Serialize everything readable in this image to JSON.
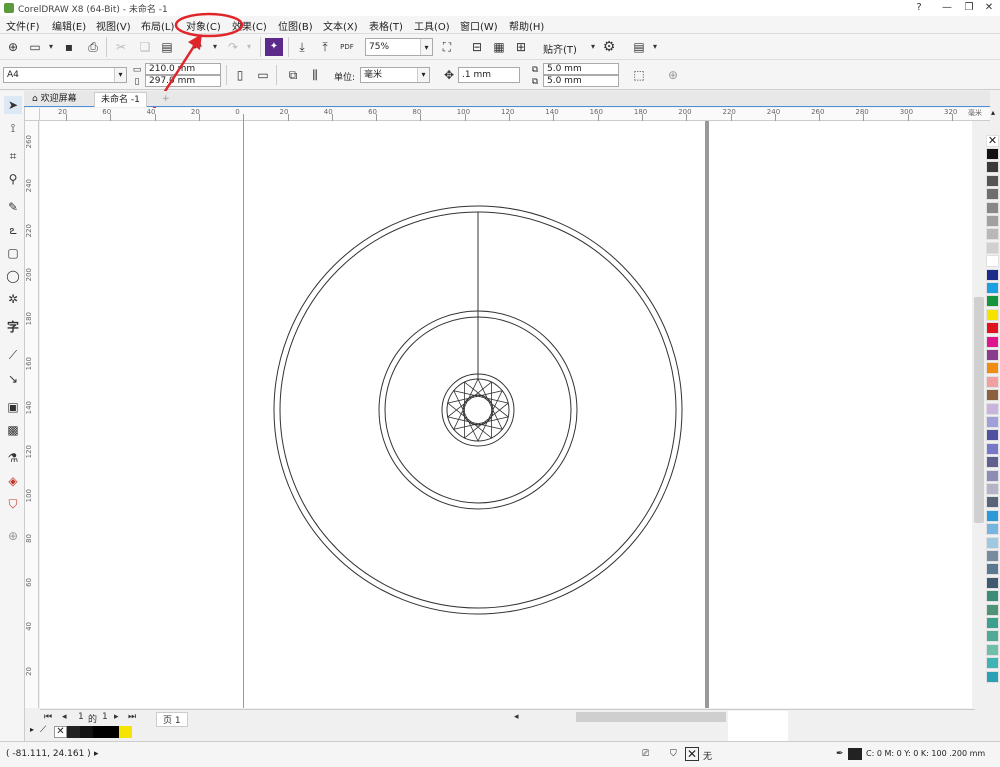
{
  "window": {
    "title": "CorelDRAW X8 (64-Bit) - 未命名 -1",
    "controls": [
      "?",
      "—",
      "❐",
      "✕"
    ]
  },
  "menu": [
    "文件(F)",
    "编辑(E)",
    "视图(V)",
    "布局(L)",
    "对象(C)",
    "效果(C)",
    "位图(B)",
    "文本(X)",
    "表格(T)",
    "工具(O)",
    "窗口(W)",
    "帮助(H)"
  ],
  "toolbar": {
    "zoom": "75%",
    "snap_label": "贴齐(T)",
    "pdf_label": "PDF"
  },
  "property_bar": {
    "page_size": "A4",
    "width": "210.0 mm",
    "height": "297.0 mm",
    "unit_label": "单位:",
    "unit": "毫米",
    "nudge": ".1 mm",
    "dup_x": "5.0 mm",
    "dup_y": "5.0 mm"
  },
  "tabs": [
    "欢迎屏幕",
    "未命名 -1"
  ],
  "ruler": {
    "h_ticks": [
      "20",
      "60",
      "40",
      "20",
      "0",
      "20",
      "40",
      "60",
      "80",
      "100",
      "120",
      "140",
      "160",
      "180",
      "200",
      "220",
      "240",
      "260",
      "280",
      "300",
      "320"
    ],
    "h_unit": "毫米",
    "v_ticks": [
      "260",
      "240",
      "220",
      "200",
      "180",
      "160",
      "140",
      "120",
      "100",
      "80",
      "60",
      "40",
      "20"
    ]
  },
  "page_nav": {
    "current": "1",
    "of_label": "的",
    "total": "1",
    "page_tab": "页 1"
  },
  "status": {
    "coords": "( -81.111, 24.161 )",
    "fill_label": "无",
    "color_info": "C: 0 M: 0 Y: 0 K: 100  .200 mm"
  },
  "colors": {
    "annotation": "#e0262b",
    "palette": [
      "#ffffff",
      "#111111",
      "#3a3a3a",
      "#555555",
      "#6e6e6e",
      "#888888",
      "#a0a0a0",
      "#b8b8b8",
      "#d0d0d0",
      "#ffffff",
      "#1c2a8a",
      "#1ea0e0",
      "#14943c",
      "#f5e400",
      "#e0141e",
      "#e0148c",
      "#8a3c8c",
      "#f08c14",
      "#f0a0a0",
      "#8a6040",
      "#c8b4dc",
      "#a0a0d8",
      "#5050a0",
      "#7878c8",
      "#606090",
      "#8c8cb4",
      "#b4b4c8",
      "#5a6478",
      "#2c9ad8",
      "#78b4e0",
      "#a0c8e0",
      "#788ca0",
      "#5a7890",
      "#405870",
      "#3c8c78",
      "#509478",
      "#3ca08c",
      "#50aa96",
      "#6ebeaa",
      "#40b4b4",
      "#2ca0b4"
    ]
  }
}
